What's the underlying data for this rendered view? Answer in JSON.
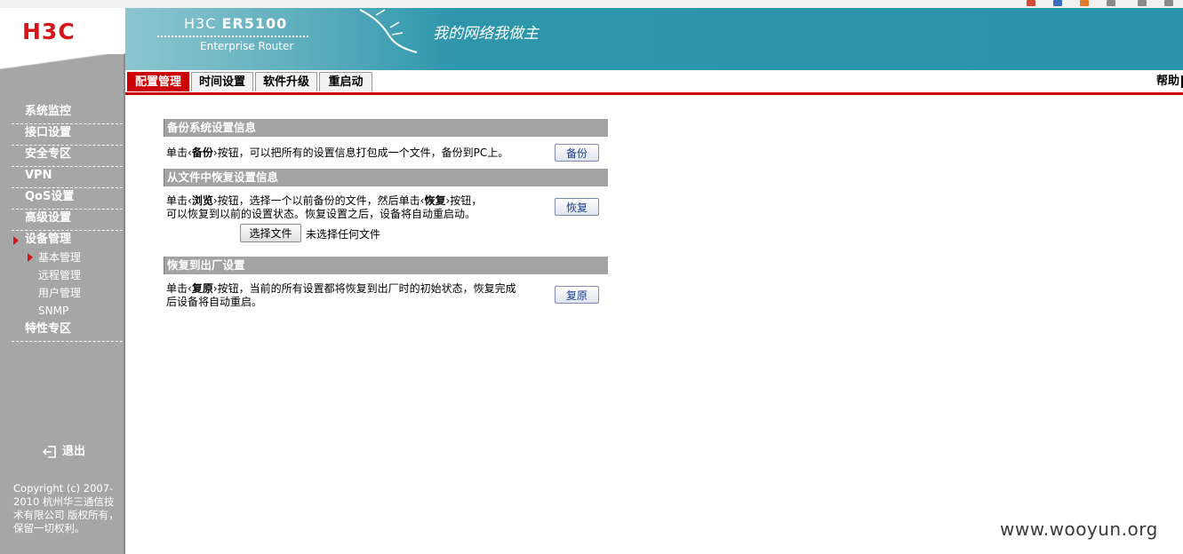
{
  "brand": {
    "logo": "H3C",
    "model_prefix": "H3C",
    "model": "ER5100",
    "subtitle": "Enterprise Router",
    "slogan": "我的网络我做主"
  },
  "tabs": [
    {
      "label": "配置管理",
      "active": true
    },
    {
      "label": "时间设置",
      "active": false
    },
    {
      "label": "软件升级",
      "active": false
    },
    {
      "label": "重启动",
      "active": false
    }
  ],
  "help_label": "帮助",
  "sidebar": {
    "items": [
      {
        "label": "系统监控"
      },
      {
        "label": "接口设置"
      },
      {
        "label": "安全专区"
      },
      {
        "label": "VPN"
      },
      {
        "label": "QoS设置"
      },
      {
        "label": "高级设置"
      },
      {
        "label": "设备管理",
        "active": true
      }
    ],
    "subitems": [
      {
        "label": "基本管理",
        "active": true
      },
      {
        "label": "远程管理"
      },
      {
        "label": "用户管理"
      },
      {
        "label": "SNMP"
      }
    ],
    "last_item": {
      "label": "特性专区"
    },
    "logout_label": "退出",
    "copyright": "Copyright (c) 2007-2010 杭州华三通信技术有限公司 版权所有，保留一切权利。"
  },
  "backup": {
    "title": "备份系统设置信息",
    "text_pre": "单击‹",
    "text_kw": "备份",
    "text_post": "›按钮，可以把所有的设置信息打包成一个文件，备份到PC上。",
    "button": "备份"
  },
  "restore": {
    "title": "从文件中恢复设置信息",
    "line1_pre": "单击‹",
    "line1_kw1": "浏览",
    "line1_mid": "›按钮，选择一个以前备份的文件，然后单击‹",
    "line1_kw2": "恢复",
    "line1_post": "›按钮，",
    "line2": "可以恢复到以前的设置状态。恢复设置之后，设备将自动重启动。",
    "file_button": "选择文件",
    "file_status": "未选择任何文件",
    "button": "恢复"
  },
  "factory": {
    "title": "恢复到出厂设置",
    "line1_pre": "单击‹",
    "line1_kw": "复原",
    "line1_post": "›按钮，当前的所有设置都将恢复到出厂时的初始状态，恢复完成",
    "line2": "后设备将自动重启。",
    "button": "复原"
  },
  "watermark": "www.wooyun.org",
  "colors": {
    "accent_red": "#cc0000",
    "banner_teal": "#2a94aa",
    "sidebar_gray": "#a6a6a6",
    "section_gray": "#a3a3a3"
  }
}
